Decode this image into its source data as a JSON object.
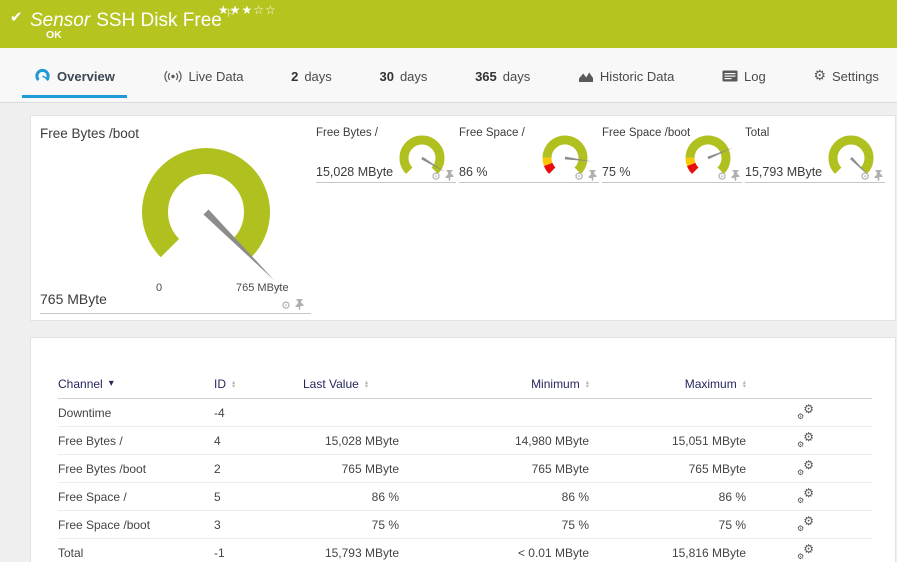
{
  "colors": {
    "brand_green": "#b5c41e",
    "gauge_green": "#b0c01e",
    "warn_yellow": "#fcc700",
    "alert_red": "#e80c0c",
    "active_tab_blue": "#1f9ad7",
    "needle": "#8c8c8c"
  },
  "icons": {
    "check": "✔",
    "flag": "⚐",
    "stars": "★★★☆☆",
    "gear": "⚙",
    "sort_up": "▴",
    "sort_down": "▾",
    "sorted_desc": "▾"
  },
  "header": {
    "type_label": "Sensor",
    "title": "SSH Disk Free",
    "status": "OK"
  },
  "tabs": [
    {
      "label": "Overview",
      "active": true
    },
    {
      "label": "Live Data"
    },
    {
      "num": "2",
      "label": "days"
    },
    {
      "num": "30",
      "label": "days"
    },
    {
      "num": "365",
      "label": "days"
    },
    {
      "label": "Historic Data"
    },
    {
      "label": "Log"
    },
    {
      "label": "Settings"
    }
  ],
  "primary_gauge": {
    "title": "Free Bytes /boot",
    "value": "765 MByte",
    "scale_min": "0",
    "scale_max": "765 MByte",
    "gauge": {
      "percent": 100,
      "marker": "x",
      "segments": [
        {
          "from": 0,
          "to": 100,
          "color": "#b0c01e"
        }
      ]
    }
  },
  "mini_gauges": [
    {
      "title": "Free Bytes /",
      "value": "15,028 MByte",
      "gauge": {
        "percent": 95,
        "segments": [
          {
            "from": 0,
            "to": 100,
            "color": "#b0c01e"
          }
        ]
      }
    },
    {
      "title": "Free Space /",
      "value": "86 %",
      "gauge": {
        "percent": 86,
        "segments": [
          {
            "from": 0,
            "to": 9,
            "color": "#e80c0c"
          },
          {
            "from": 9,
            "to": 17,
            "color": "#fcc700"
          },
          {
            "from": 17,
            "to": 100,
            "color": "#b0c01e"
          }
        ]
      }
    },
    {
      "title": "Free Space /boot",
      "value": "75 %",
      "gauge": {
        "percent": 75,
        "segments": [
          {
            "from": 0,
            "to": 9,
            "color": "#e80c0c"
          },
          {
            "from": 9,
            "to": 17,
            "color": "#fcc700"
          },
          {
            "from": 17,
            "to": 100,
            "color": "#b0c01e"
          }
        ]
      }
    },
    {
      "title": "Total",
      "value": "15,793 MByte",
      "gauge": {
        "percent": 100,
        "segments": [
          {
            "from": 0,
            "to": 100,
            "color": "#b0c01e"
          }
        ]
      }
    }
  ],
  "table": {
    "columns": {
      "channel": "Channel",
      "id": "ID",
      "last": "Last Value",
      "min": "Minimum",
      "max": "Maximum"
    },
    "rows": [
      {
        "channel": "Downtime",
        "id": "-4",
        "last": "",
        "min": "",
        "max": ""
      },
      {
        "channel": "Free Bytes /",
        "id": "4",
        "last": "15,028 MByte",
        "min": "14,980 MByte",
        "max": "15,051 MByte"
      },
      {
        "channel": "Free Bytes /boot",
        "id": "2",
        "last": "765 MByte",
        "min": "765 MByte",
        "max": "765 MByte"
      },
      {
        "channel": "Free Space /",
        "id": "5",
        "last": "86 %",
        "min": "86 %",
        "max": "86 %"
      },
      {
        "channel": "Free Space /boot",
        "id": "3",
        "last": "75 %",
        "min": "75 %",
        "max": "75 %"
      },
      {
        "channel": "Total",
        "id": "-1",
        "last": "15,793 MByte",
        "min": "< 0.01 MByte",
        "max": "15,816 MByte"
      }
    ]
  }
}
